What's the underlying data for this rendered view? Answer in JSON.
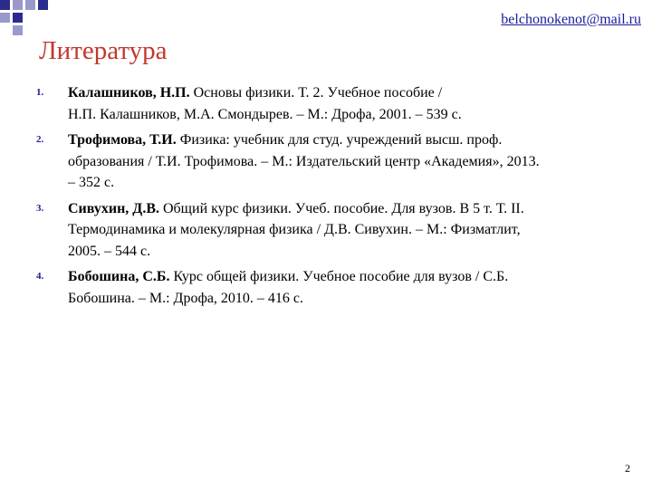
{
  "colors": {
    "accent": "#2B2B8F",
    "accent_light": "#9999CC",
    "link": "#1A1A99",
    "title": "#C0392B",
    "number": "#1A1A99",
    "text": "#000000"
  },
  "header": {
    "email": "belchonokenot@mail.ru"
  },
  "slide": {
    "title": "Литература",
    "page_number": "2"
  },
  "references": [
    {
      "number": "1.",
      "author": "Калашников, Н.П.",
      "text_lines": [
        " Основы физики. Т. 2. Учебное пособие /",
        "Н.П. Калашников, М.А. Смондырев. – М.: Дрофа, 2001. – 539 с."
      ]
    },
    {
      "number": "2.",
      "author": "Трофимова, Т.И.",
      "text_lines": [
        " Физика: учебник для студ. учреждений высш. проф.",
        "образования / Т.И. Трофимова. – М.: Издательский центр «Академия», 2013.",
        "– 352 с."
      ]
    },
    {
      "number": "3.",
      "author": "Сивухин, Д.В.",
      "text_lines": [
        " Общий курс физики. Учеб. пособие. Для вузов. В 5 т. Т. II.",
        "Термодинамика и молекулярная физика / Д.В. Сивухин. – М.: Физматлит,",
        "2005. – 544 с."
      ]
    },
    {
      "number": "4.",
      "author": "Бобошина, С.Б.",
      "text_lines": [
        " Курс общей физики. Учебное пособие для вузов / С.Б.",
        "Бобошина. – М.: Дрофа, 2010. – 416 с."
      ]
    }
  ]
}
